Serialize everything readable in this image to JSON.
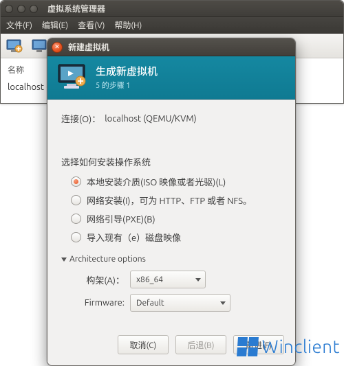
{
  "main": {
    "title": "虚拟系统管理器",
    "menu": {
      "file": "文件(F)",
      "edit": "编辑(E)",
      "view": "查看(V)",
      "help": "帮助(H)"
    },
    "col_name": "名称",
    "conn_name": "localhost (Q"
  },
  "dialog": {
    "titlebar": "新建虚拟机",
    "header_title": "生成新虚拟机",
    "header_step": "5 的步骤 1",
    "connection_label": "连接(O)：",
    "connection_value": "localhost (QEMU/KVM)",
    "install_section": "选择如何安装操作系统",
    "options": {
      "local": "本地安装介质(ISO 映像或者光驱)(L)",
      "net": "网络安装(I)，可为 HTTP、FTP 或者 NFS。",
      "pxe": "网络引导(PXE)(B)",
      "import": "导入现有（e）磁盘映像"
    },
    "arch_expander": "Architecture options",
    "arch_label": "构架(A)：",
    "arch_value": "x86_64",
    "firmware_label": "Firmware:",
    "firmware_value": "Default",
    "buttons": {
      "cancel": "取消(C)",
      "back": "后退(B)",
      "forward": "前进(F)"
    }
  },
  "watermark": "Winclient"
}
